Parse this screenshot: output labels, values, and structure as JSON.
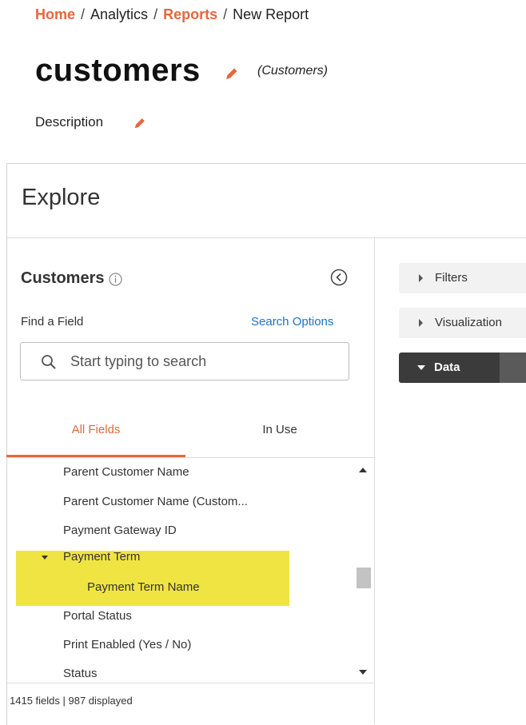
{
  "breadcrumb": {
    "items": [
      {
        "label": "Home",
        "link": true
      },
      {
        "label": "Analytics",
        "link": false
      },
      {
        "label": "Reports",
        "link": true
      },
      {
        "label": "New Report",
        "link": false
      }
    ],
    "separator": "/"
  },
  "report": {
    "title": "customers",
    "model_label": "(Customers)",
    "description_label": "Description"
  },
  "explore": {
    "title": "Explore",
    "view_name": "Customers",
    "find_field_label": "Find a Field",
    "search_options_label": "Search Options",
    "search_placeholder": "Start typing to search",
    "search_value": "",
    "tabs": [
      {
        "label": "All Fields",
        "active": true
      },
      {
        "label": "In Use",
        "active": false
      }
    ],
    "fields": [
      {
        "label": "Parent Customer Name"
      },
      {
        "label": "Parent Customer Name (Custom..."
      },
      {
        "label": "Payment Gateway ID"
      },
      {
        "label": "Payment Term",
        "group": true,
        "expanded": true
      },
      {
        "label": "Payment Term Name",
        "child": true
      },
      {
        "label": "Portal Status"
      },
      {
        "label": "Print Enabled (Yes / No)"
      },
      {
        "label": "Status"
      }
    ],
    "footer": "1415 fields | 987 displayed"
  },
  "right_panel": {
    "sections": [
      {
        "label": "Filters",
        "expanded": false
      },
      {
        "label": "Visualization",
        "expanded": false
      },
      {
        "label": "Data",
        "expanded": true
      }
    ]
  },
  "colors": {
    "accent": "#e8663d",
    "link": "#1a73c8",
    "highlight": "#f0e442",
    "data_bar": "#3b3b3b"
  }
}
